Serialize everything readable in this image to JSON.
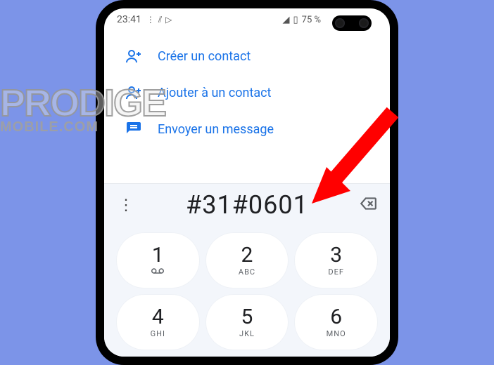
{
  "status": {
    "time": "23:41",
    "battery": "75 %"
  },
  "actions": {
    "create": "Créer un contact",
    "add": "Ajouter à un contact",
    "message": "Envoyer un message"
  },
  "dial": {
    "entered": "#31#0601"
  },
  "keypad": [
    {
      "digit": "1",
      "letters": "⊄"
    },
    {
      "digit": "2",
      "letters": "ABC"
    },
    {
      "digit": "3",
      "letters": "DEF"
    },
    {
      "digit": "4",
      "letters": "GHI"
    },
    {
      "digit": "5",
      "letters": "JKL"
    },
    {
      "digit": "6",
      "letters": "MNO"
    }
  ],
  "watermark": {
    "line1": "PRODIGE",
    "line2": "MOBILE.COM"
  }
}
